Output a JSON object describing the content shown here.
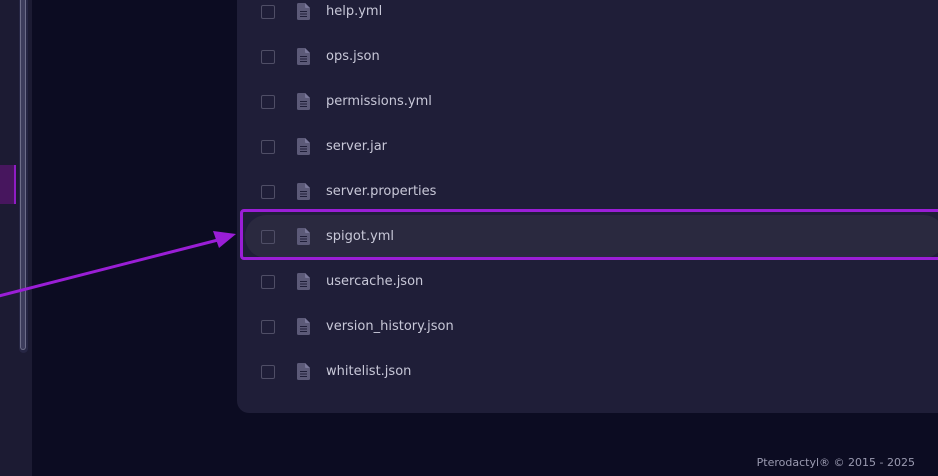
{
  "files": [
    {
      "name": "help.yml"
    },
    {
      "name": "ops.json"
    },
    {
      "name": "permissions.yml"
    },
    {
      "name": "server.jar"
    },
    {
      "name": "server.properties"
    },
    {
      "name": "spigot.yml",
      "highlighted": true
    },
    {
      "name": "usercache.json"
    },
    {
      "name": "version_history.json"
    },
    {
      "name": "whitelist.json"
    }
  ],
  "footer": {
    "copyright": "Pterodactyl® © 2015 - 2025"
  },
  "colors": {
    "page_bg": "#0c0c22",
    "panel_bg": "#1f1e38",
    "highlight": "#9a1ed6",
    "file_icon": "#5c5a78",
    "text": "#c8c8d8"
  },
  "icons": {
    "file": "file-icon",
    "arrow": "annotation-arrow"
  }
}
